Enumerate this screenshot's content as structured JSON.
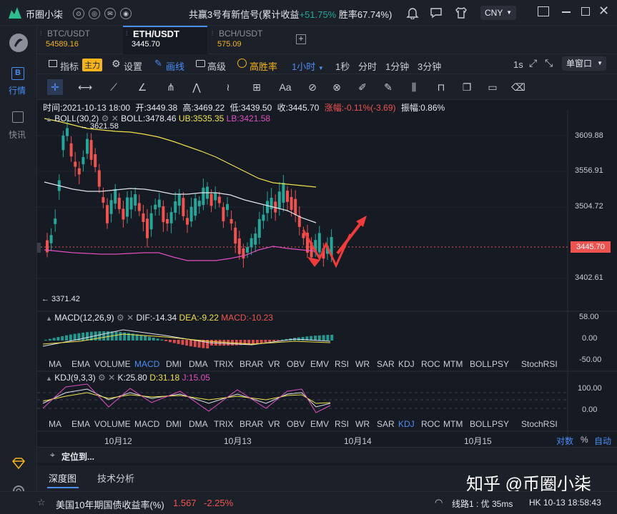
{
  "app": {
    "name": "币圈小柒",
    "banner": "共赢3号有新信号(累计收益",
    "banner_gain": "+51.75%",
    "banner_winrate": " 胜率67.74%)",
    "currency": "CNY",
    "left_nav": [
      {
        "label": "行情"
      },
      {
        "label": "快讯"
      }
    ]
  },
  "tabs": [
    {
      "name": "BTC/USDT",
      "price": "54589.16"
    },
    {
      "name": "ETH/USDT",
      "price": "3445.70"
    },
    {
      "name": "BCH/USDT",
      "price": "575.09"
    }
  ],
  "toolbar": {
    "indicator": "指标",
    "main_badge": "主力",
    "settings": "设置",
    "draw": "画线",
    "advanced": "高级",
    "winrate": "高胜率",
    "interval_selected": "1小时",
    "intervals": [
      "1秒",
      "分时",
      "1分钟",
      "3分钟"
    ],
    "right_interval": "1s",
    "window_mode": "单窗口"
  },
  "ohlc": {
    "time": "时间:2021-10-13 18:00",
    "open": "开:3449.38",
    "high": "高:3469.22",
    "low": "低:3439.50",
    "close": "收:3445.70",
    "change": "涨幅:-0.11%(-3.69)",
    "amplitude": "振幅:0.86%"
  },
  "boll": {
    "name": "BOLL(30,2)",
    "mid": "BOLL:3478.46",
    "ub": "UB:3535.35",
    "lb": "LB:3421.58"
  },
  "macd": {
    "name": "MACD(12,26,9)",
    "dif": "DIF:-14.34",
    "dea": "DEA:-9.22",
    "macd": "MACD:-10.23",
    "axis": [
      "58.00",
      "0.00",
      "-50.00"
    ]
  },
  "kdj": {
    "name": "KDJ(9,3,3)",
    "k": "K:25.80",
    "d": "D:31.18",
    "j": "J:15.05",
    "axis": [
      "100.00",
      "0.00"
    ]
  },
  "indicator_tabs": [
    "MA",
    "EMA",
    "VOLUME",
    "MACD",
    "DMI",
    "DMA",
    "TRIX",
    "BRAR",
    "VR",
    "OBV",
    "EMV",
    "RSI",
    "WR",
    "SAR",
    "KDJ",
    "ROC",
    "MTM",
    "BOLL",
    "PSY",
    "StochRSI"
  ],
  "price_axis": [
    "3609.88",
    "3556.91",
    "3504.72",
    "3402.61"
  ],
  "current_price": "3445.70",
  "annotations": {
    "high": "← 3621.58",
    "low": "← 3371.42"
  },
  "x_axis": [
    "10月12",
    "10月13",
    "10月14",
    "10月15"
  ],
  "axis_controls": {
    "log": "对数",
    "percent": "%",
    "auto": "自动"
  },
  "locate": "定位到...",
  "bottom_tabs": [
    "深度图",
    "技术分析"
  ],
  "watermark": "知乎 @币圈小柒",
  "status": {
    "ticker": "美国10年期国债收益率(%)",
    "ticker_value": "1.567",
    "ticker_change": "-2.25%",
    "line": "线路1 : 优 35ms",
    "clock": "HK 10-13 18:58:43"
  },
  "colors": {
    "up": "#26a69a",
    "down": "#ef5350",
    "accent": "#4a8df6",
    "gold": "#f5b31c",
    "ub": "#f0e14a",
    "lb": "#e04fc0"
  }
}
